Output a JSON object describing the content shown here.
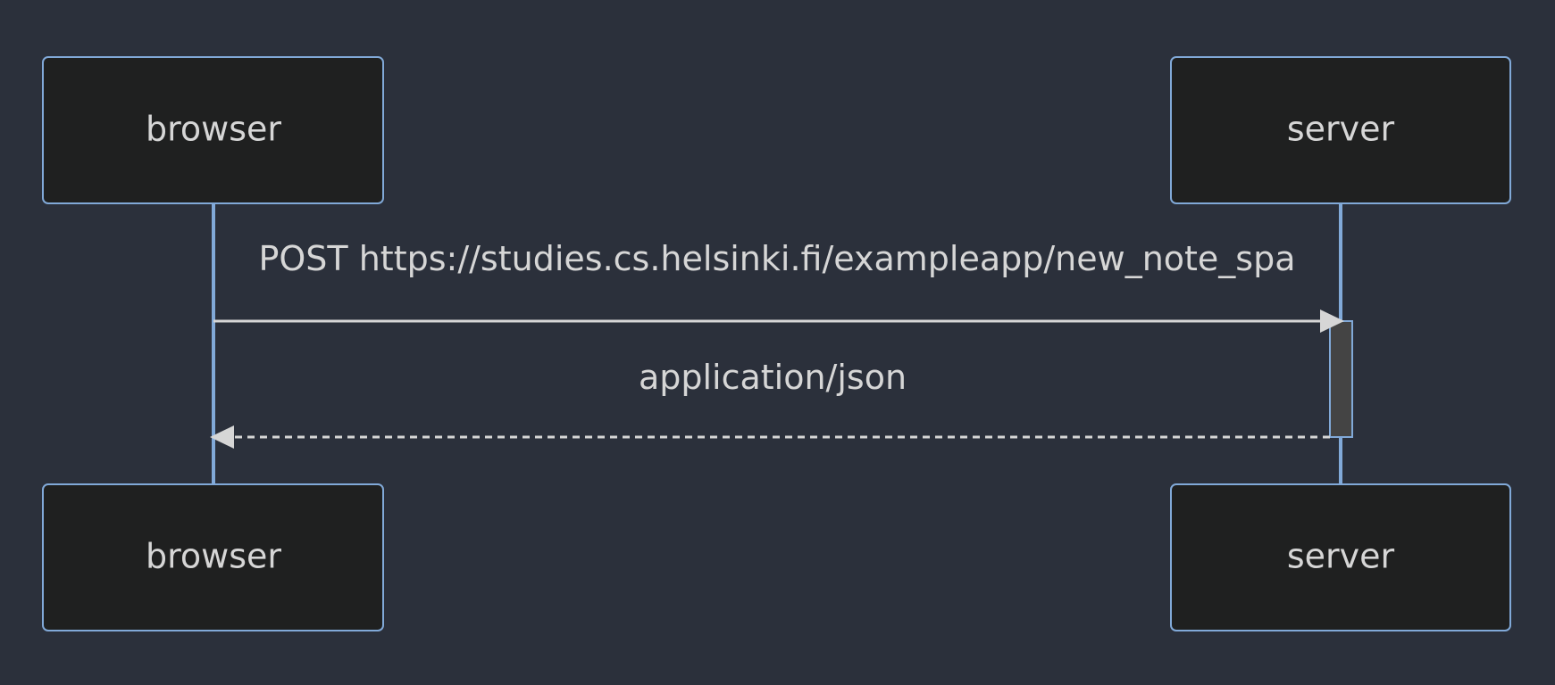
{
  "participants": [
    {
      "id": "browser",
      "label": "browser"
    },
    {
      "id": "server",
      "label": "server"
    }
  ],
  "messages": [
    {
      "from": "browser",
      "to": "server",
      "label": "POST https://studies.cs.helsinki.fi/exampleapp/new_note_spa",
      "style": "solid"
    },
    {
      "from": "server",
      "to": "browser",
      "label": "application/json",
      "style": "dashed"
    }
  ],
  "colors": {
    "background": "#2b303b",
    "actor_fill": "#1f2020",
    "actor_border": "#81a9d8",
    "text": "#d6d6d6",
    "activation_fill": "#444444"
  }
}
